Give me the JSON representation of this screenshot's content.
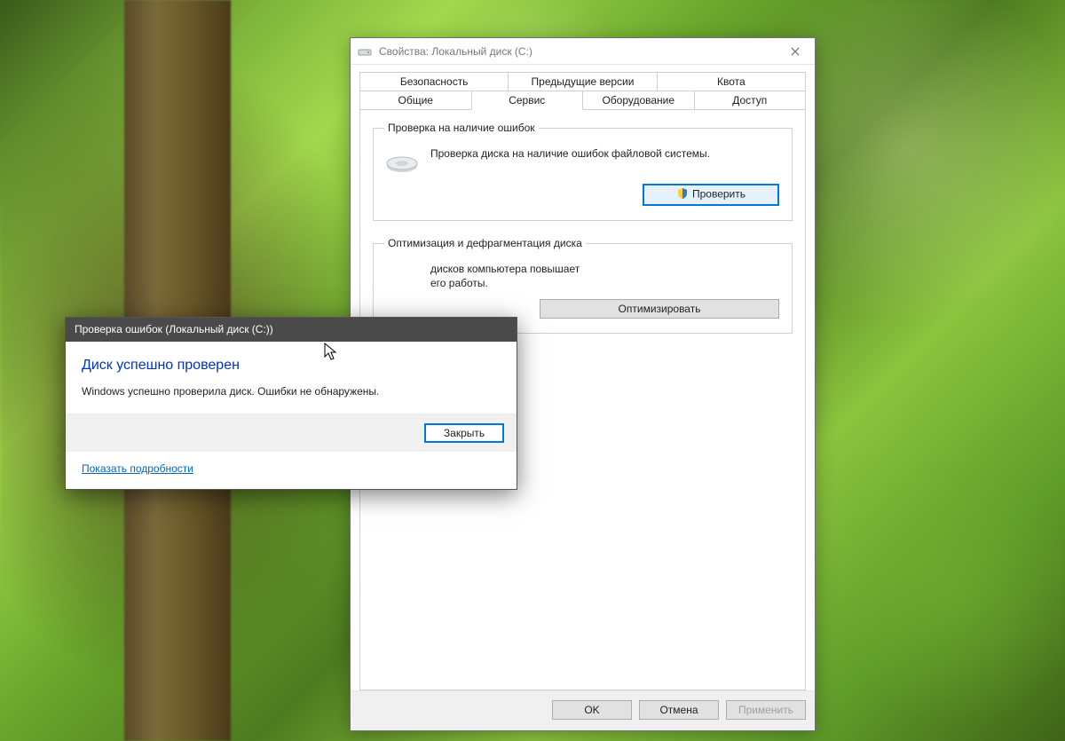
{
  "propWindow": {
    "title": "Свойства: Локальный диск (C:)",
    "tabsRow1": [
      {
        "label": "Безопасность"
      },
      {
        "label": "Предыдущие версии"
      },
      {
        "label": "Квота"
      }
    ],
    "tabsRow2": [
      {
        "label": "Общие"
      },
      {
        "label": "Сервис",
        "active": true
      },
      {
        "label": "Оборудование"
      },
      {
        "label": "Доступ"
      }
    ],
    "errorCheck": {
      "legend": "Проверка на наличие ошибок",
      "text": "Проверка диска на наличие ошибок файловой системы.",
      "button": "Проверить"
    },
    "optimize": {
      "legend": "Оптимизация и дефрагментация диска",
      "textPartial": "дисков компьютера повышает его работы.",
      "textVisibleLine1": "дисков компьютера повышает",
      "textVisibleLine2": "его работы.",
      "button": "Оптимизировать"
    },
    "buttons": {
      "ok": "OK",
      "cancel": "Отмена",
      "apply": "Применить"
    }
  },
  "msgDialog": {
    "title": "Проверка ошибок (Локальный диск (C:))",
    "heading": "Диск успешно проверен",
    "body": "Windows успешно проверила диск. Ошибки не обнаружены.",
    "close": "Закрыть",
    "details": "Показать подробности"
  }
}
